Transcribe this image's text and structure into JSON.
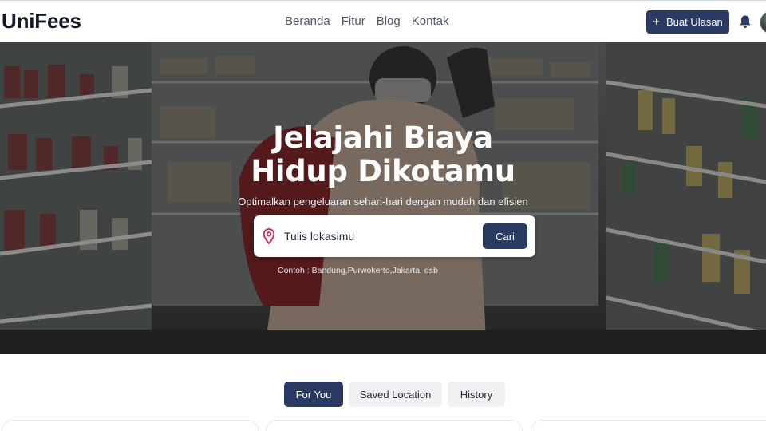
{
  "navbar": {
    "brand": "UniFees",
    "links": [
      "Beranda",
      "Fitur",
      "Blog",
      "Kontak"
    ],
    "review_button_label": "Buat Ulasan",
    "review_button_icon": "plus-icon",
    "notification_icon": "bell-icon"
  },
  "hero": {
    "title_line1": "Jelajahi Biaya",
    "title_line2": "Hidup Dikotamu",
    "subtitle": "Optimalkan pengeluaran sehari-hari dengan mudah dan efisien",
    "search": {
      "placeholder": "Tulis lokasimu",
      "value": "",
      "button_label": "Cari",
      "icon": "map-pin-icon"
    },
    "example_text": "Contoh : Bandung,Purwokerto,Jakarta, dsb"
  },
  "tabs": [
    {
      "label": "For You",
      "active": true
    },
    {
      "label": "Saved Location",
      "active": false
    },
    {
      "label": "History",
      "active": false
    }
  ],
  "colors": {
    "primary": "#2b3a63",
    "pin": "#e11d48"
  }
}
